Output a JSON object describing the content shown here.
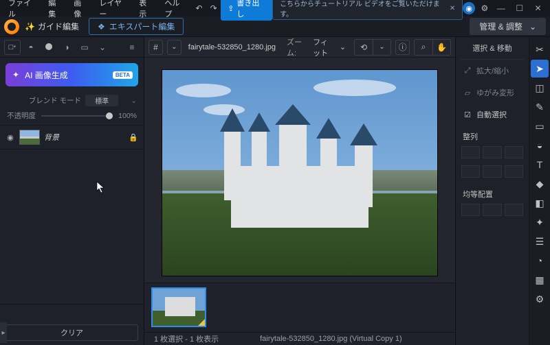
{
  "menu": {
    "file": "ファイル",
    "edit": "編集",
    "image": "画像",
    "layer": "レイヤー",
    "view": "表示",
    "help": "ヘルプ"
  },
  "titlebar": {
    "export": "書き出し",
    "tutorial": "こちらからチュートリアル ビデオをご覧いただけます。"
  },
  "editbar": {
    "guide": "ガイド編集",
    "expert": "エキスパート編集",
    "manage": "管理 & 調整"
  },
  "left": {
    "ai": "AI 画像生成",
    "ai_badge": "BETA",
    "blend_label": "ブレンド モード",
    "blend_value": "標準",
    "opacity_label": "不透明度",
    "opacity_value": "100%",
    "layer_name": "背景",
    "clear": "クリア"
  },
  "center": {
    "filename": "fairytale-532850_1280.jpg",
    "zoom_label": "ズーム:",
    "zoom_value": "フィット",
    "status_sel": "1 枚選択 - 1 枚表示",
    "status_file": "fairytale-532850_1280.jpg (Virtual Copy 1)"
  },
  "right": {
    "head": "選択 & 移動",
    "zoom": "拡大/縮小",
    "distort": "ゆがみ変形",
    "autoselect": "自動選択",
    "align": "整列",
    "distribute": "均等配置"
  }
}
